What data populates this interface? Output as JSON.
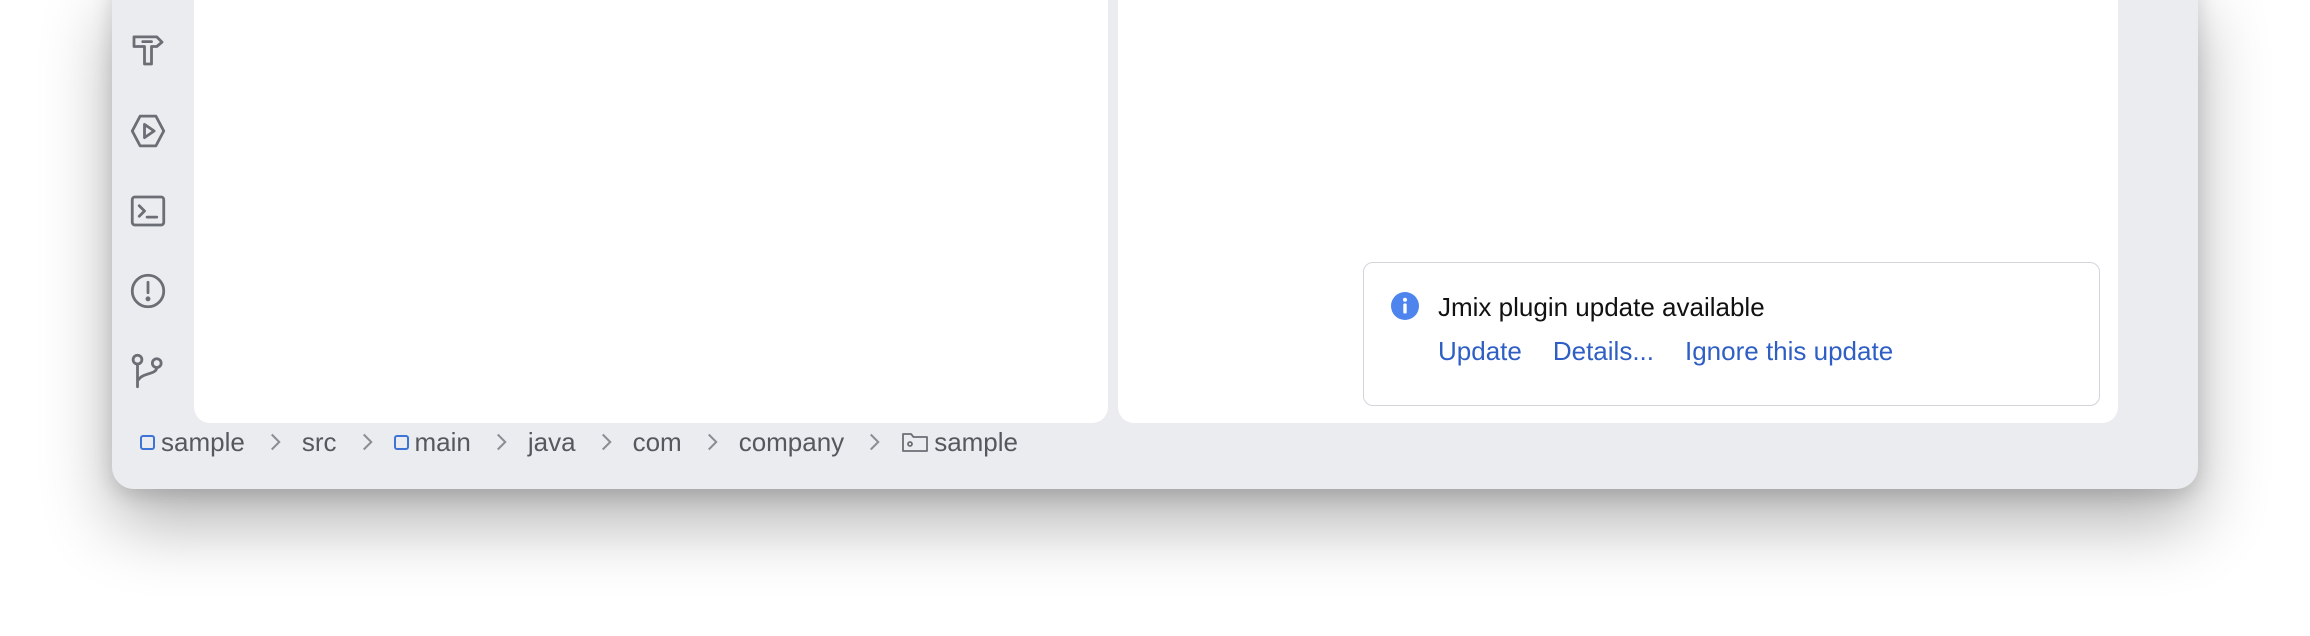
{
  "toolwindow_icons": [
    {
      "name": "build-icon"
    },
    {
      "name": "run-icon"
    },
    {
      "name": "terminal-icon"
    },
    {
      "name": "problems-icon"
    },
    {
      "name": "git-icon"
    }
  ],
  "notification": {
    "title": "Jmix plugin update available",
    "actions": {
      "update": "Update",
      "details": "Details...",
      "ignore": "Ignore this update"
    },
    "icon": "info-icon",
    "accent_color": "#4d84ee"
  },
  "breadcrumb": {
    "items": [
      {
        "label": "sample",
        "icon": "module-icon"
      },
      {
        "label": "src"
      },
      {
        "label": "main",
        "icon": "module-icon"
      },
      {
        "label": "java"
      },
      {
        "label": "com"
      },
      {
        "label": "company"
      },
      {
        "label": "sample",
        "icon": "package-folder-icon"
      }
    ]
  }
}
